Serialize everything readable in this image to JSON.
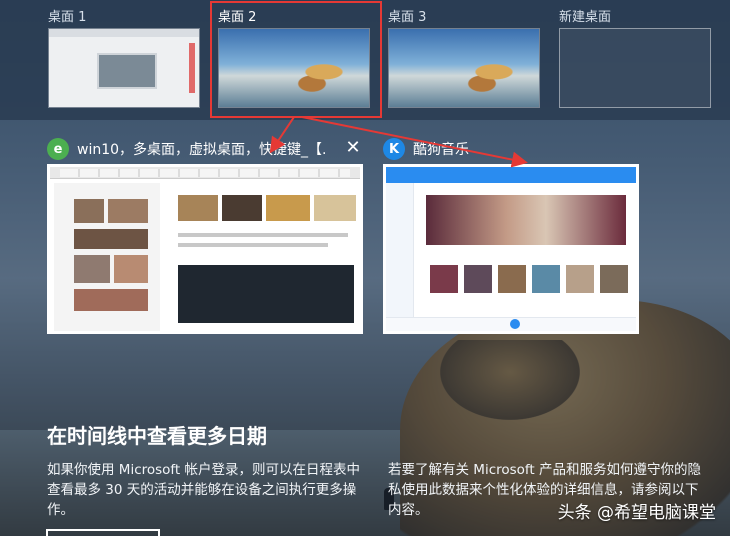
{
  "desktops": [
    {
      "label": "桌面 1"
    },
    {
      "label": "桌面 2"
    },
    {
      "label": "桌面 3"
    },
    {
      "label": "新建桌面"
    }
  ],
  "windows": [
    {
      "title": "win10，多桌面，虚拟桌面，快捷键_【...",
      "icon": "ie-browser-icon"
    },
    {
      "title": "酷狗音乐",
      "icon": "kugou-music-icon"
    }
  ],
  "timeline": {
    "title": "在时间线中查看更多日期",
    "left_text": "如果你使用 Microsoft 帐户登录，则可以在日程表中查看最多 30 天的活动并能够在设备之间执行更多操作。",
    "right_text": "若要了解有关 Microsoft 产品和服务如何遵守你的隐私使用此数据来个性化体验的详细信息，请参阅以下内容。"
  },
  "watermark": "头条 @希望电脑课堂",
  "colors": {
    "highlight": "#e53935",
    "desktop_bar": "#283a50"
  }
}
